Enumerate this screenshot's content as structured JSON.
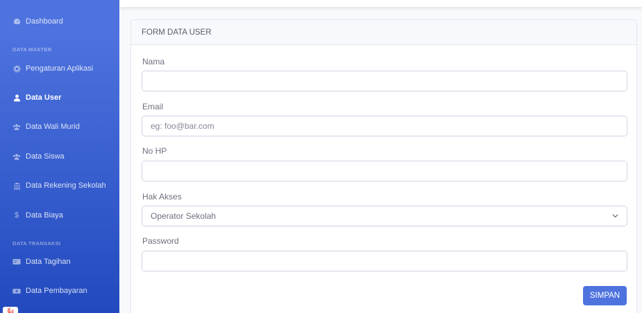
{
  "sidebar": {
    "dashboard": "Dashboard",
    "heading_master": "DATA MASTER",
    "items_master": [
      {
        "label": "Pengaturan Aplikasi",
        "icon": "gear-icon"
      },
      {
        "label": "Data User",
        "icon": "user-icon",
        "active": true
      },
      {
        "label": "Data Wali Murid",
        "icon": "users-icon"
      },
      {
        "label": "Data Siswa",
        "icon": "users-icon"
      },
      {
        "label": "Data Rekening Sekolah",
        "icon": "bank-icon"
      },
      {
        "label": "Data Biaya",
        "icon": "dollar-icon"
      }
    ],
    "heading_transaksi": "DATA TRANSAKSI",
    "items_transaksi": [
      {
        "label": "Data Tagihan",
        "icon": "invoice-icon"
      },
      {
        "label": "Data Pembayaran",
        "icon": "money-icon"
      }
    ],
    "corner_badge": "ฉิ่ง",
    "bg_colors": [
      "#4e73df",
      "#224abe"
    ]
  },
  "form": {
    "title": "FORM DATA USER",
    "nama_label": "Nama",
    "nama_value": "",
    "email_label": "Email",
    "email_placeholder": "eg: foo@bar.com",
    "nohp_label": "No HP",
    "nohp_value": "",
    "hakakses_label": "Hak Akses",
    "hakakses_value": "Operator Sekolah",
    "password_label": "Password",
    "password_value": "",
    "submit_label": "SIMPAN",
    "accent": "#4e73df"
  }
}
